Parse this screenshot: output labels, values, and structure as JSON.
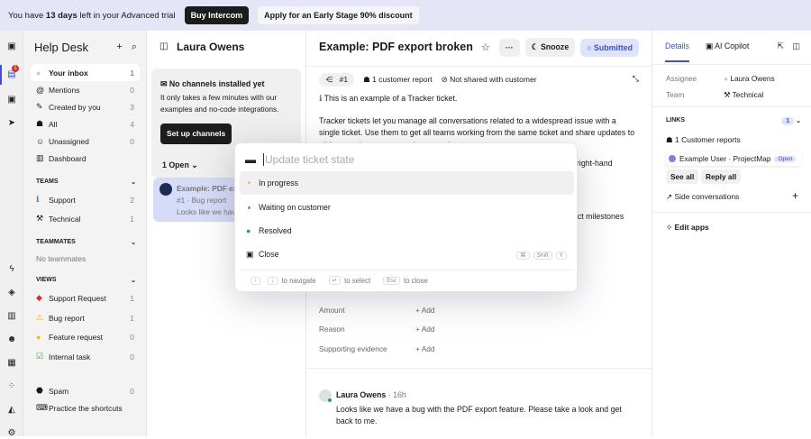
{
  "banner": {
    "pre": "You have ",
    "days": "13 days",
    "post": " left in your Advanced trial",
    "buy": "Buy Intercom",
    "discount": "Apply for an Early Stage 90% discount"
  },
  "rail": {
    "inbox_badge": "1"
  },
  "sidebar": {
    "title": "Help Desk",
    "items": [
      {
        "label": "Your inbox",
        "count": "1"
      },
      {
        "label": "Mentions",
        "count": "0"
      },
      {
        "label": "Created by you",
        "count": "3"
      },
      {
        "label": "All",
        "count": "4"
      },
      {
        "label": "Unassigned",
        "count": "0"
      },
      {
        "label": "Dashboard",
        "count": ""
      }
    ],
    "teams_header": "TEAMS",
    "teams": [
      {
        "label": "Support",
        "count": "2"
      },
      {
        "label": "Technical",
        "count": "1"
      }
    ],
    "teammates_header": "TEAMMATES",
    "no_teammates": "No teammates",
    "views_header": "VIEWS",
    "views": [
      {
        "label": "Support Request",
        "count": "1"
      },
      {
        "label": "Bug report",
        "count": "1"
      },
      {
        "label": "Feature request",
        "count": "0"
      },
      {
        "label": "Internal task",
        "count": "0"
      }
    ],
    "spam": {
      "label": "Spam",
      "count": "0"
    },
    "shortcuts": "Practice the shortcuts"
  },
  "inbox": {
    "title": "Laura Owens",
    "channels_title": "No channels installed yet",
    "channels_text": "It only takes a few minutes with our examples and no-code integrations.",
    "setup": "Set up channels",
    "open_filter": "1 Open",
    "card": {
      "title": "Example: PDF ex",
      "sub": "#1 · Bug report",
      "preview": "Looks like we hav"
    }
  },
  "ticket": {
    "title": "Example: PDF export broken",
    "snooze": "Snooze",
    "state": "Submitted",
    "id": "#1",
    "reports": "1 customer report",
    "shared": "Not shared with customer",
    "intro": "This is an example of a Tracker ticket.",
    "para": "Tracker tickets let you manage all conversations related to a widespread issue with a single ticket. Use them to get all teams working from the same ticket and share updates to all impacted customers at the same time.",
    "frag1": "right-hand",
    "frag2": "ect milestones",
    "fields": [
      {
        "label": "Amount",
        "value": "+ Add"
      },
      {
        "label": "Reason",
        "value": "+ Add"
      },
      {
        "label": "Supporting evidence",
        "value": "+ Add"
      }
    ],
    "message": {
      "author": "Laura Owens",
      "time": "· 16h",
      "text": "Looks like we have a bug with the PDF export feature. Please take a look and get back to me."
    }
  },
  "popup": {
    "placeholder": "Update ticket state",
    "options": [
      "In progress",
      "Waiting on customer",
      "Resolved",
      "Close"
    ],
    "shortcut": [
      "⌘",
      "Shift",
      "Y"
    ],
    "nav_hint": "to navigate",
    "select_hint": "to select",
    "esc": "Esc",
    "close_hint": "to close"
  },
  "details": {
    "tab_details": "Details",
    "tab_copilot": "AI Copilot",
    "assignee_label": "Assignee",
    "assignee": "Laura Owens",
    "team_label": "Team",
    "team": "Technical",
    "links": "LINKS",
    "links_count": "1",
    "customer_reports": "1 Customer reports",
    "linked": "Example User · ProjectMap",
    "linked_status": "Open",
    "see_all": "See all",
    "reply_all": "Reply all",
    "side_conv": "Side conversations",
    "edit_apps": "Edit apps"
  }
}
